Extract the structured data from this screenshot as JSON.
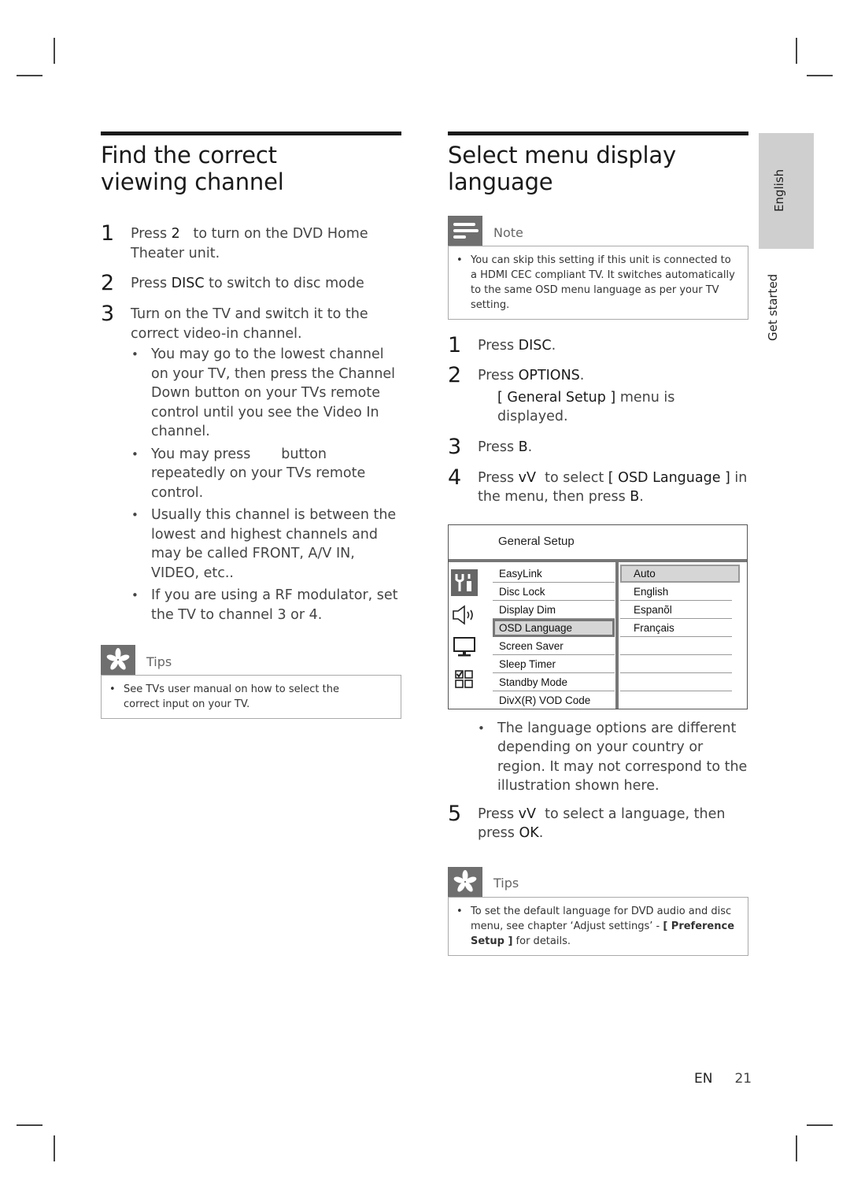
{
  "left_section": {
    "title": "Find the correct viewing channel",
    "steps": [
      {
        "num": "1",
        "parts": [
          "Press ",
          "2",
          "   to turn on the DVD Home Theater unit."
        ]
      },
      {
        "num": "2",
        "parts": [
          "Press ",
          "DISC",
          " to switch to disc mode"
        ]
      },
      {
        "num": "3",
        "text": "Turn on the TV and switch it to the correct video-in channel."
      }
    ],
    "bullets": [
      "You may go to the lowest channel on your TV, then press the Channel Down button on your TVs remote control until you see the Video In channel.",
      "You may press       button repeatedly on your TVs remote control.",
      "Usually this channel is between the lowest and highest channels and may be called FRONT, A/V IN, VIDEO, etc..",
      "If you are using a RF modulator, set the TV to channel 3 or 4."
    ],
    "tips": {
      "label": "Tips",
      "text": "See TVs user manual on how to select the correct input on your TV."
    }
  },
  "right_section": {
    "title": "Select menu display language",
    "note": {
      "label": "Note",
      "text": "You can skip this setting if this unit is connected to a HDMI CEC compliant TV. It switches automatically to the same OSD menu language as per your TV setting."
    },
    "steps": [
      {
        "num": "1",
        "parts": [
          "Press ",
          "DISC",
          "."
        ]
      },
      {
        "num": "2",
        "parts": [
          "Press ",
          "OPTIONS",
          "."
        ],
        "sub": [
          "[ General Setup ]",
          " menu is displayed."
        ]
      },
      {
        "num": "3",
        "parts": [
          "Press ",
          "B",
          "."
        ]
      },
      {
        "num": "4",
        "parts": [
          "Press ",
          "vV",
          "  to select ",
          "[ OSD Language ]",
          " in the menu, then press ",
          "B",
          "."
        ]
      }
    ],
    "menu": {
      "title": "General Setup",
      "icons": [
        "general-setup-icon",
        "audio-setup-icon",
        "video-setup-icon",
        "preference-setup-icon"
      ],
      "items": [
        "EasyLink",
        "Disc Lock",
        "Display Dim",
        "OSD Language",
        "Screen Saver",
        "Sleep Timer",
        "Standby Mode",
        "DivX(R) VOD Code"
      ],
      "selected_item": "OSD Language",
      "options": [
        "Auto",
        "English",
        "Espanõl",
        "Français",
        "",
        "",
        "",
        ""
      ],
      "selected_option": "Auto"
    },
    "bullet": "The language options are different depending on your country or region. It may not correspond to the illustration shown here.",
    "step5": {
      "num": "5",
      "parts": [
        "Press ",
        "vV",
        "  to select a language, then press ",
        "OK",
        "."
      ]
    },
    "tips": {
      "label": "Tips",
      "text_parts": [
        "To set the default language for DVD audio and disc menu, see chapter ‘Adjust settings’ - ",
        "[ Preference Setup ]",
        " for details."
      ]
    }
  },
  "side_tabs": {
    "language": "English",
    "chapter": "Get started"
  },
  "footer": {
    "lang": "EN",
    "page": "21"
  }
}
